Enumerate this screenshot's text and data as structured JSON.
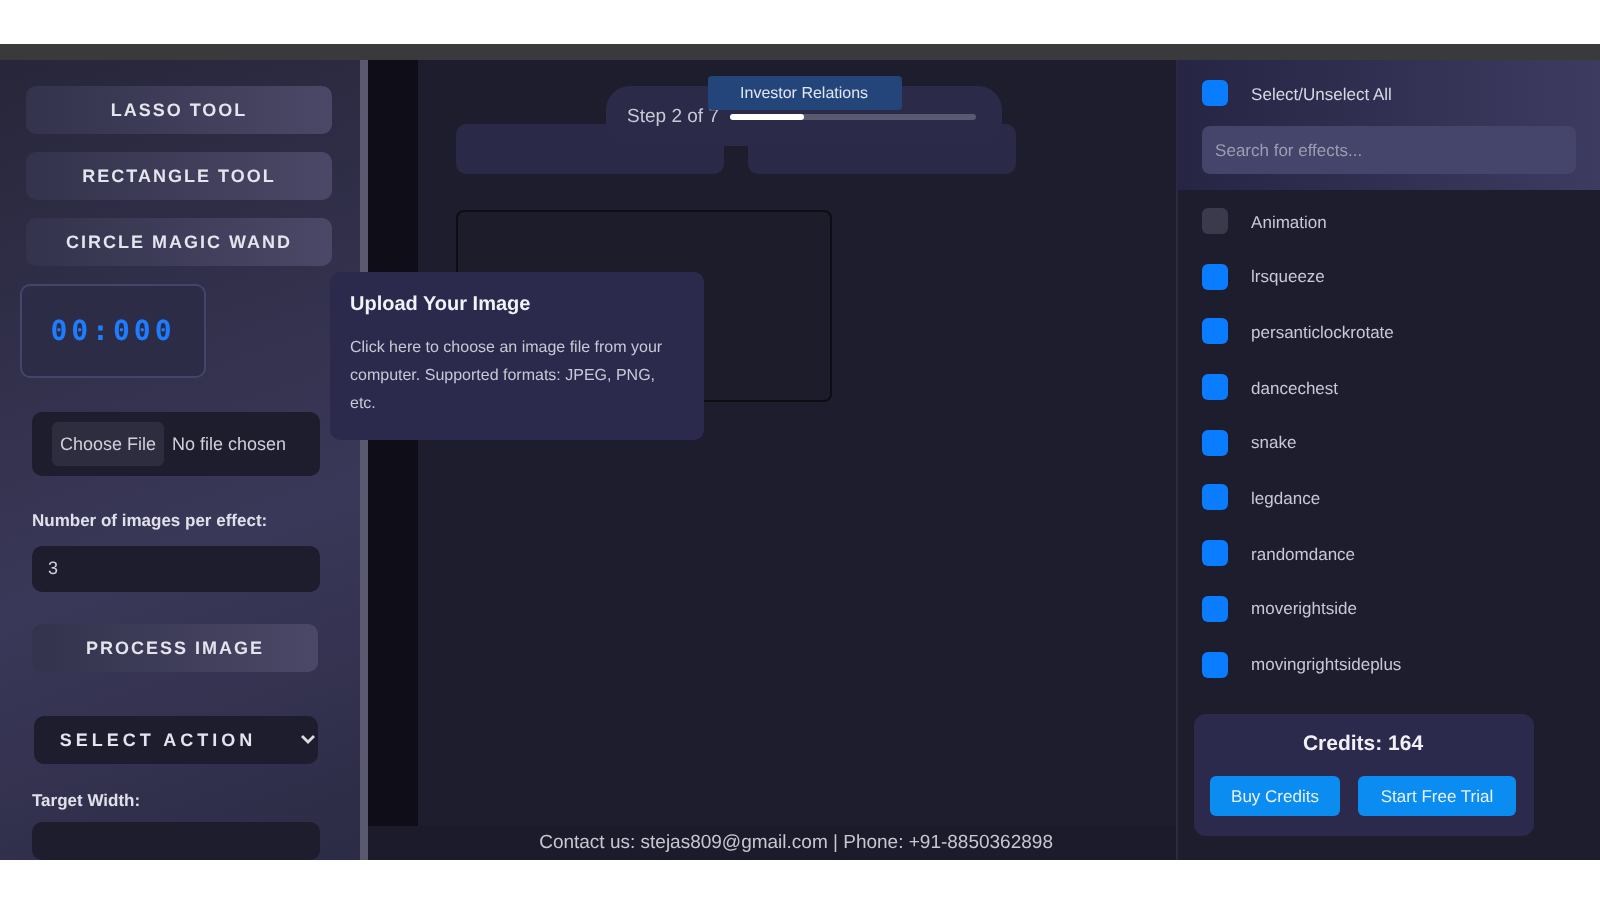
{
  "sidebar": {
    "tools": [
      "LASSO TOOL",
      "RECTANGLE TOOL",
      "CIRCLE MAGIC WAND"
    ],
    "timer": "00:000",
    "file_input": {
      "button": "Choose File",
      "status": "No file chosen"
    },
    "images_label": "Number of images per effect:",
    "images_value": "3",
    "process_button": "PROCESS IMAGE",
    "select_action": "SELECT ACTION",
    "target_width_label": "Target Width:"
  },
  "step": {
    "tab": "Investor Relations",
    "text": "Step 2 of 7",
    "level": 0.3
  },
  "tooltip": {
    "title": "Upload Your Image",
    "body": "Click here to choose an image file from your computer. Supported formats: JPEG, PNG, etc."
  },
  "footer": "Contact us: stejas809@gmail.com | Phone: +91-8850362898",
  "effects": {
    "select_all": {
      "label": "Select/Unselect All",
      "checked": true
    },
    "search": {
      "placeholder": "Search for effects..."
    },
    "items": [
      {
        "label": "Animation",
        "checked": false
      },
      {
        "label": "lrsqueeze",
        "checked": true
      },
      {
        "label": "persanticlockrotate",
        "checked": true
      },
      {
        "label": "dancechest",
        "checked": true
      },
      {
        "label": "snake",
        "checked": true
      },
      {
        "label": "legdance",
        "checked": true
      },
      {
        "label": "randomdance",
        "checked": true
      },
      {
        "label": "moverightside",
        "checked": true
      },
      {
        "label": "movingrightsideplus",
        "checked": true
      }
    ]
  },
  "credits": {
    "text": "Credits: 164",
    "buttons": [
      "Buy Credits",
      "Start Free Trial"
    ]
  }
}
